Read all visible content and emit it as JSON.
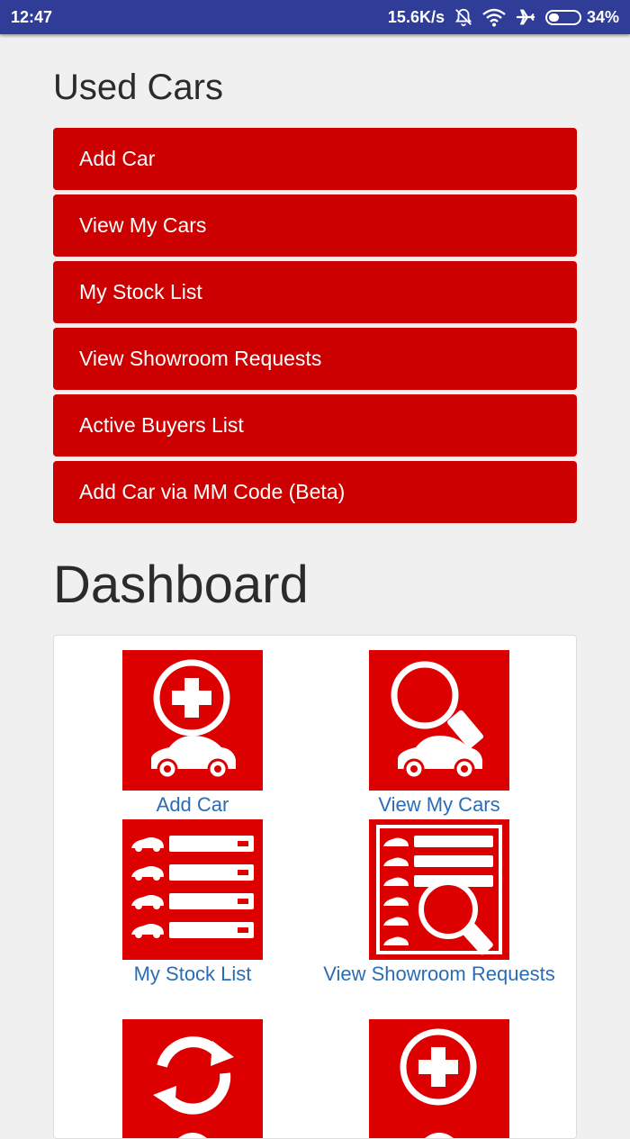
{
  "status_bar": {
    "time": "12:47",
    "network_speed": "15.6K/s",
    "battery_percent": "34%",
    "battery_level": 0.34,
    "icons": [
      "mute-icon",
      "wifi-icon",
      "airplane-icon",
      "battery-icon"
    ]
  },
  "used_cars": {
    "title": "Used Cars",
    "buttons": [
      {
        "label": "Add Car"
      },
      {
        "label": "View My Cars"
      },
      {
        "label": "My Stock List"
      },
      {
        "label": "View Showroom Requests"
      },
      {
        "label": "Active Buyers List"
      },
      {
        "label": "Add Car via MM Code (Beta)"
      }
    ]
  },
  "dashboard": {
    "title": "Dashboard",
    "tiles": [
      {
        "label": "Add Car",
        "icon": "add-car-icon"
      },
      {
        "label": "View My Cars",
        "icon": "search-car-icon"
      },
      {
        "label": "My Stock List",
        "icon": "stock-list-icon"
      },
      {
        "label": "View Showroom Requests",
        "icon": "showroom-requests-icon"
      },
      {
        "label": "",
        "icon": "refresh-icon"
      },
      {
        "label": "",
        "icon": "add-icon"
      }
    ]
  },
  "colors": {
    "status_bar": "#2f3d99",
    "button_red": "#cc0000",
    "tile_red": "#dd0000",
    "link_blue": "#2a6db5",
    "background": "#f0f0f0"
  }
}
